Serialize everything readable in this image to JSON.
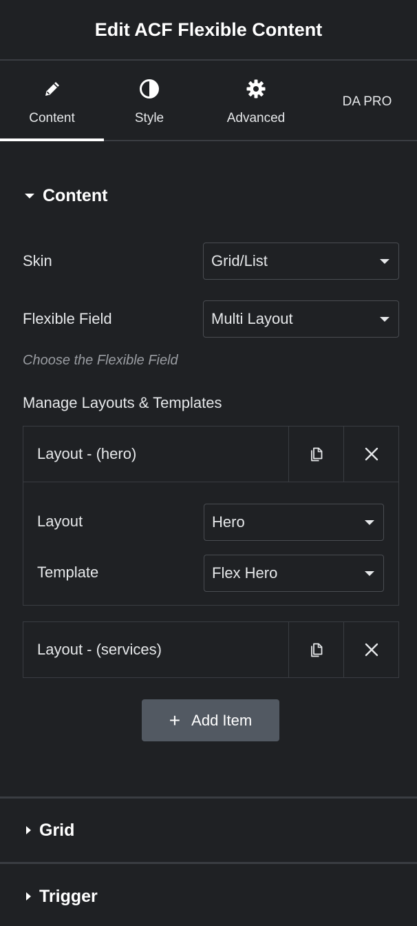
{
  "header": {
    "title": "Edit ACF Flexible Content"
  },
  "tabs": [
    {
      "label": "Content",
      "icon": "pencil-icon",
      "active": true
    },
    {
      "label": "Style",
      "icon": "half-circle-icon",
      "active": false
    },
    {
      "label": "Advanced",
      "icon": "gear-icon",
      "active": false
    },
    {
      "label": "DA PRO",
      "icon": "",
      "active": false
    }
  ],
  "content_section": {
    "title": "Content",
    "skin": {
      "label": "Skin",
      "value": "Grid/List"
    },
    "flexible_field": {
      "label": "Flexible Field",
      "value": "Multi Layout",
      "help": "Choose the Flexible Field"
    },
    "manage_label": "Manage Layouts & Templates",
    "items": [
      {
        "title": "Layout - (hero)",
        "expanded": true,
        "layout": {
          "label": "Layout",
          "value": "Hero"
        },
        "template": {
          "label": "Template",
          "value": "Flex Hero"
        }
      },
      {
        "title": "Layout - (services)",
        "expanded": false
      }
    ],
    "add_item_label": "Add Item"
  },
  "sections": [
    {
      "title": "Grid"
    },
    {
      "title": "Trigger"
    }
  ],
  "colors": {
    "background": "#1f2124",
    "border": "#3a3d42",
    "button": "#525962",
    "text": "#e6e8ea",
    "muted": "#9a9da2"
  }
}
